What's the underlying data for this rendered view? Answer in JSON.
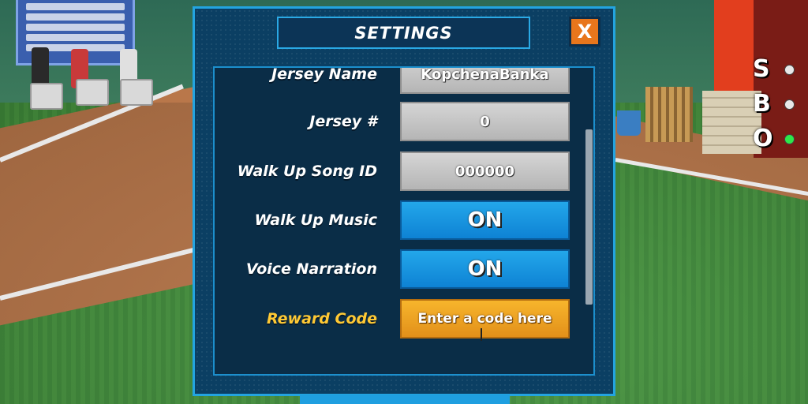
{
  "settings": {
    "title": "SETTINGS",
    "close_label": "X",
    "rows": [
      {
        "label": "Jersey Name",
        "value": "KopchenaBanka"
      },
      {
        "label": "Jersey #",
        "value": "0"
      },
      {
        "label": "Walk Up Song ID",
        "value": "000000"
      },
      {
        "label": "Walk Up Music",
        "value": "ON"
      },
      {
        "label": "Voice Narration",
        "value": "ON"
      },
      {
        "label": "Reward Code",
        "placeholder": "Enter a code here"
      }
    ]
  },
  "hud": {
    "letters": [
      "S",
      "B",
      "O"
    ]
  },
  "colors": {
    "panel_bg": "#0b3f63",
    "panel_border": "#23a4e0",
    "toggle_on": "#1a9be3",
    "reward_field": "#f0a726",
    "reward_label": "#ffc934",
    "close_button": "#e8761c"
  }
}
